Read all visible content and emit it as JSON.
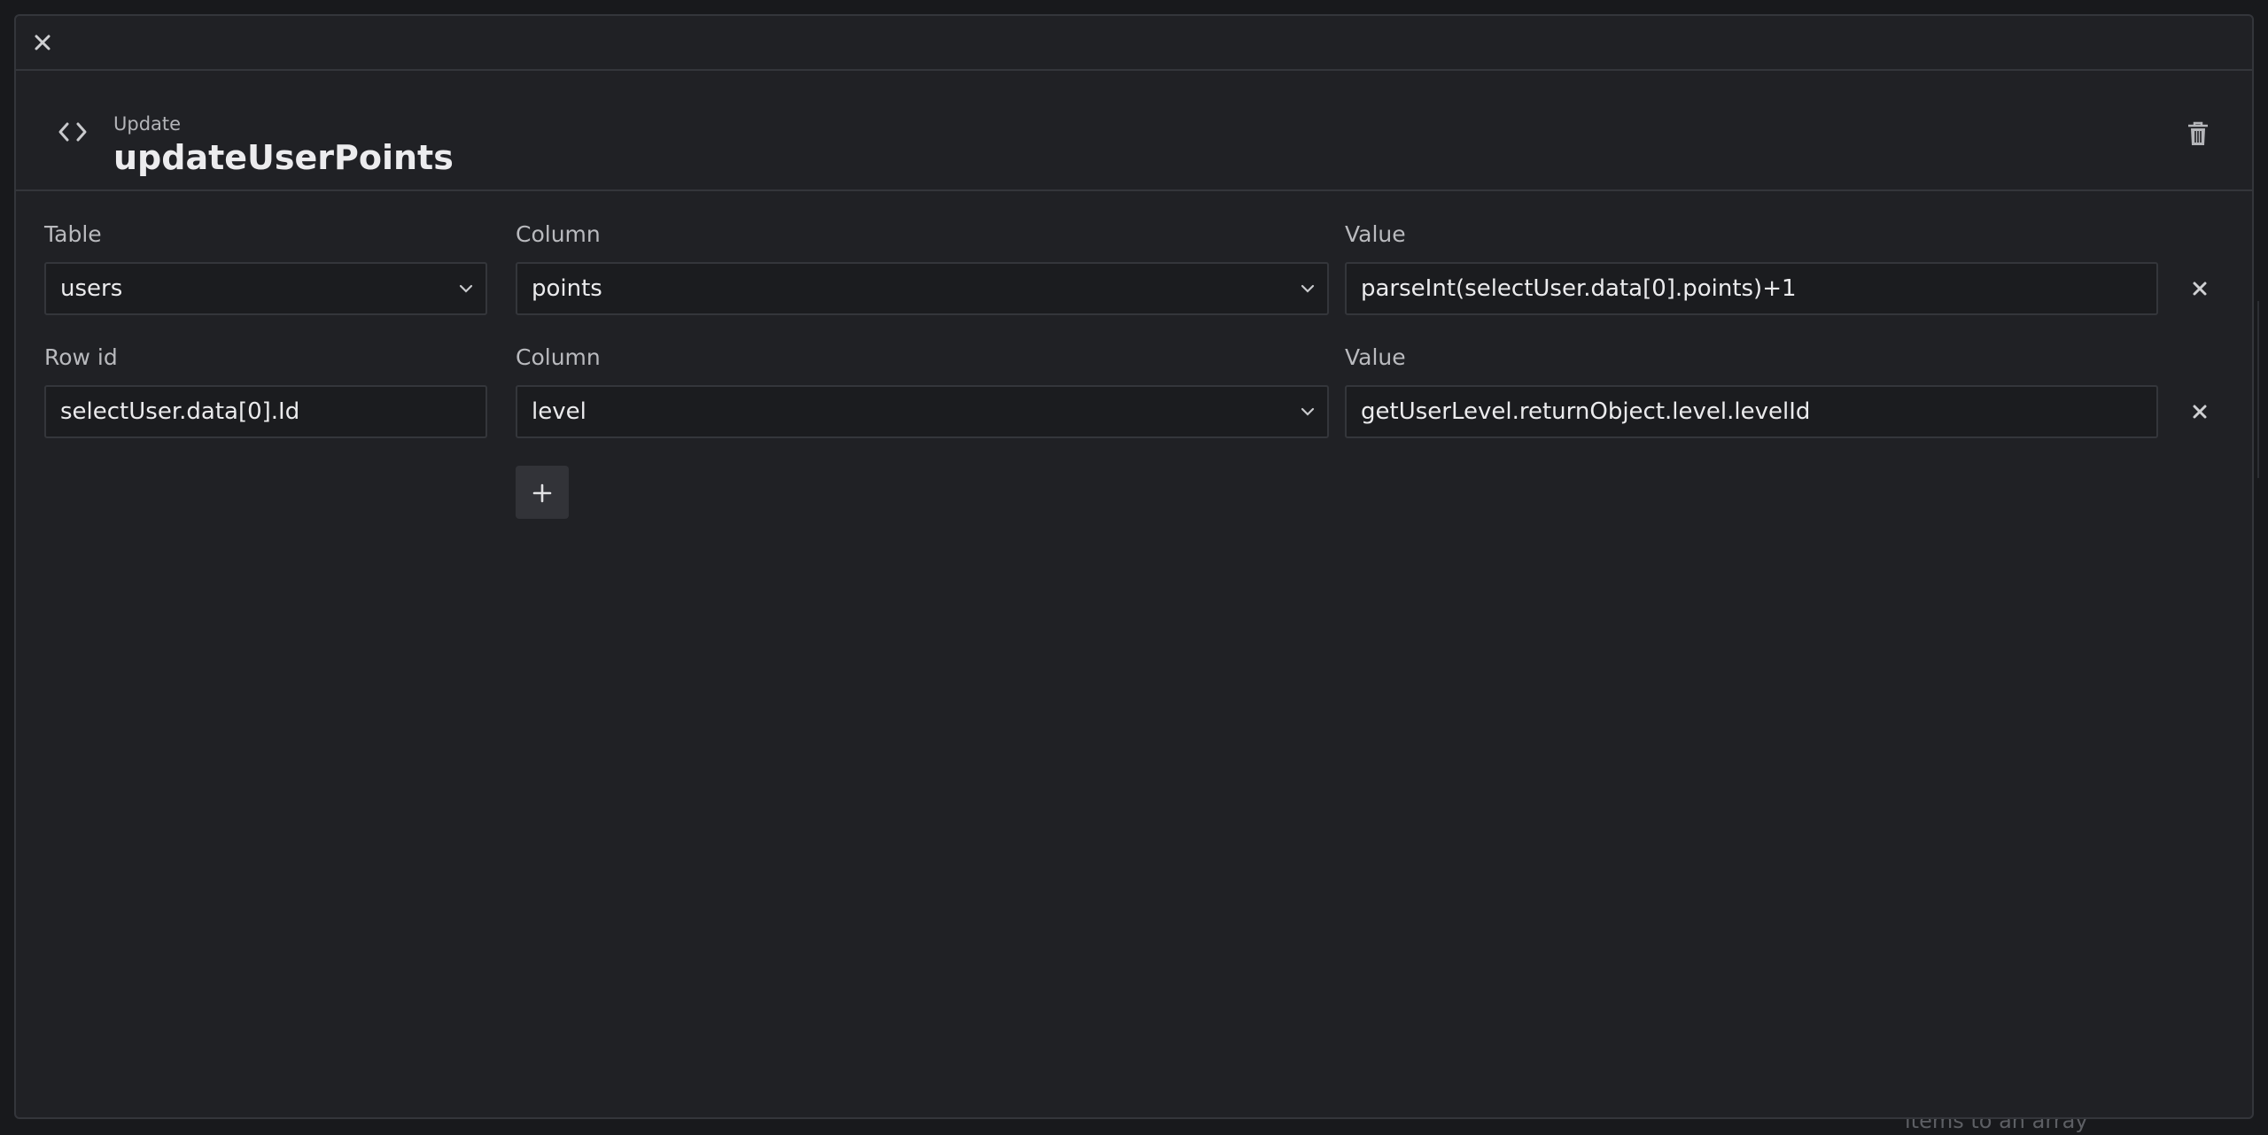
{
  "background": {
    "hint_text": "items to an array"
  },
  "topbar": {
    "close_icon": "close-icon"
  },
  "header": {
    "icon": "code-icon",
    "subtitle": "Update",
    "title": "updateUserPoints",
    "delete_icon": "trash-icon"
  },
  "row1": {
    "table_label": "Table",
    "table_value": "users",
    "column_label": "Column",
    "column_value": "points",
    "value_label": "Value",
    "value_value": "parseInt(selectUser.data[0].points)+1"
  },
  "row2": {
    "rowid_label": "Row id",
    "rowid_value": "selectUser.data[0].Id",
    "column_label": "Column",
    "column_value": "level",
    "value_label": "Value",
    "value_value": "getUserLevel.returnObject.level.levelId"
  },
  "add_button_icon": "plus-icon",
  "colors": {
    "modal_bg": "#202125",
    "field_bg": "#1b1c1f",
    "border": "#34363b",
    "button_bg": "#323338"
  }
}
